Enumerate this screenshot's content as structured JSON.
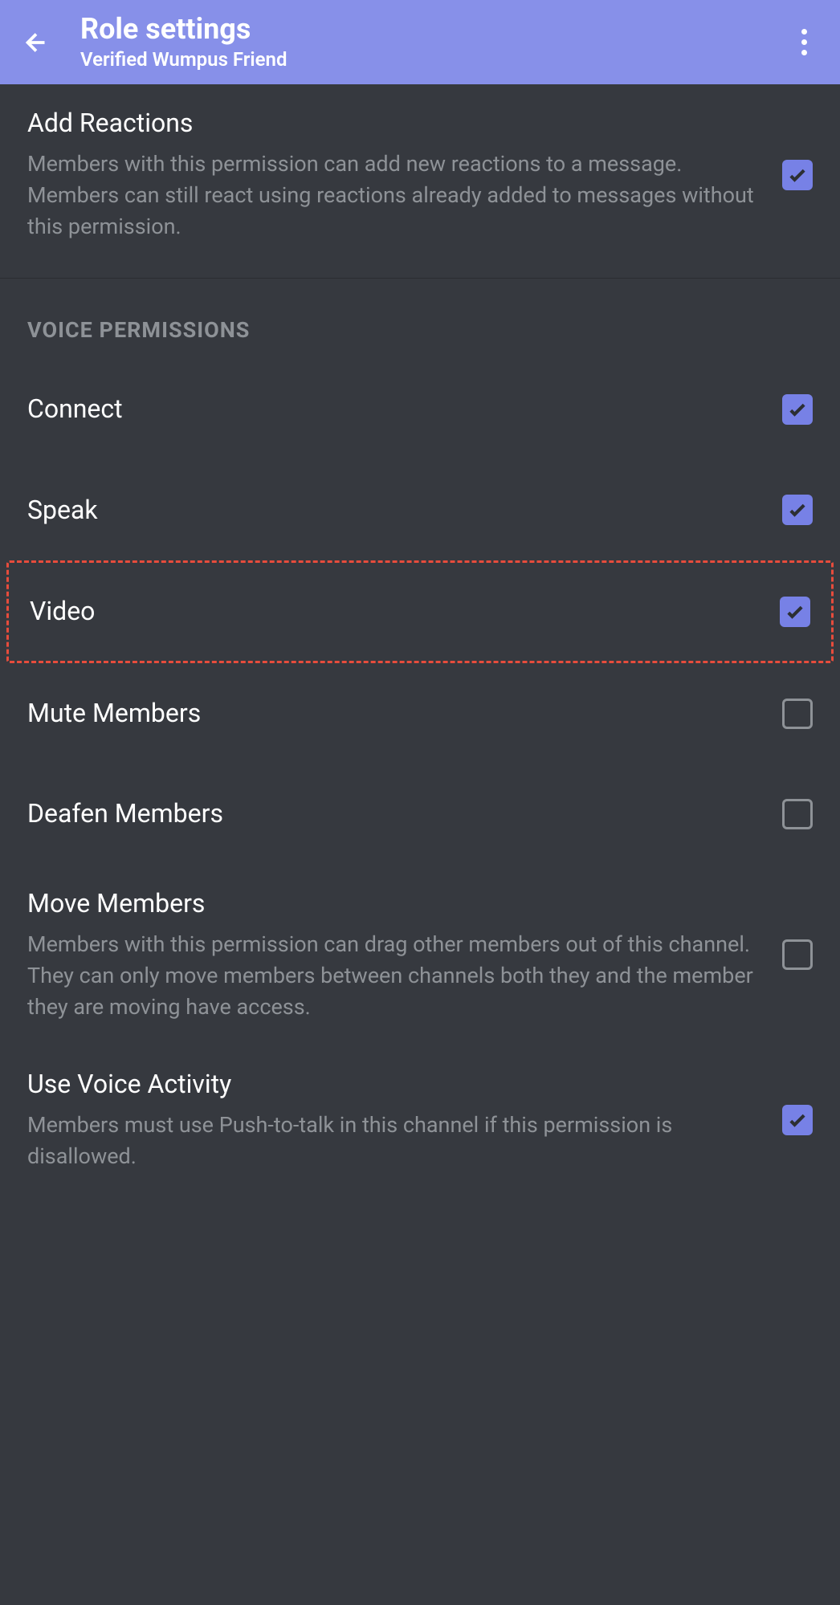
{
  "header": {
    "title": "Role settings",
    "subtitle": "Verified Wumpus Friend"
  },
  "sections": {
    "addReactions": {
      "title": "Add Reactions",
      "description": "Members with this permission can add new reactions to a message. Members can still react using reactions already added to messages without this permission.",
      "checked": true
    },
    "voicePermissionsHeader": "VOICE PERMISSIONS",
    "connect": {
      "title": "Connect",
      "checked": true
    },
    "speak": {
      "title": "Speak",
      "checked": true
    },
    "video": {
      "title": "Video",
      "checked": true
    },
    "muteMembers": {
      "title": "Mute Members",
      "checked": false
    },
    "deafenMembers": {
      "title": "Deafen Members",
      "checked": false
    },
    "moveMembers": {
      "title": "Move Members",
      "description": "Members with this permission can drag other members out of this channel. They can only move members between channels both they and the member they are moving have access.",
      "checked": false
    },
    "useVoiceActivity": {
      "title": "Use Voice Activity",
      "description": "Members must use Push-to-talk in this channel if this permission is disallowed.",
      "checked": true
    }
  }
}
